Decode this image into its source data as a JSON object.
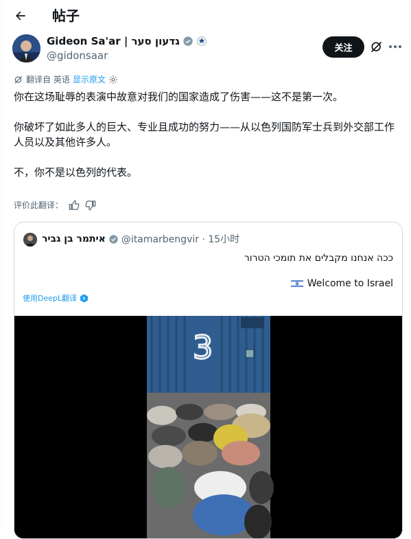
{
  "header": {
    "title": "帖子"
  },
  "author": {
    "name": "Gideon Sa'ar | גדעון סער",
    "handle": "@gidonsaar",
    "follow_label": "关注"
  },
  "translation": {
    "from_label": "翻译自 英语",
    "show_original_label": "显示原文"
  },
  "post": {
    "paragraphs": [
      "你在这场耻辱的表演中故意对我们的国家造成了伤害——这不是第一次。",
      "你破坏了如此多人的巨大、专业且成功的努力——从以色列国防军士兵到外交部工作人员以及其他许多人。",
      "不，你不是以色列的代表。"
    ],
    "rate_label": "评价此翻译："
  },
  "quote": {
    "name": "איתמר בן גביר",
    "handle_time": "@itamarbengvir · 15小时",
    "hebrew_text": "ככה אנחנו מקבלים את תומכי הטרור",
    "welcome_text": "Welcome to Israel",
    "deepl_label": "使用DeepL翻译",
    "container_number": "3"
  },
  "colors": {
    "accent": "#1d9bf0",
    "text": "#0f1419",
    "muted": "#536471",
    "follow_bg": "#0f1419",
    "border": "#cfd9de",
    "container_blue": "#2f5d8f"
  },
  "icons": [
    "back-arrow-icon",
    "verified-badge-icon",
    "affiliate-badge-icon",
    "grok-icon",
    "more-icon",
    "translate-icon",
    "settings-icon",
    "thumbs-up-icon",
    "thumbs-down-icon",
    "israel-flag-icon",
    "deepl-icon"
  ]
}
